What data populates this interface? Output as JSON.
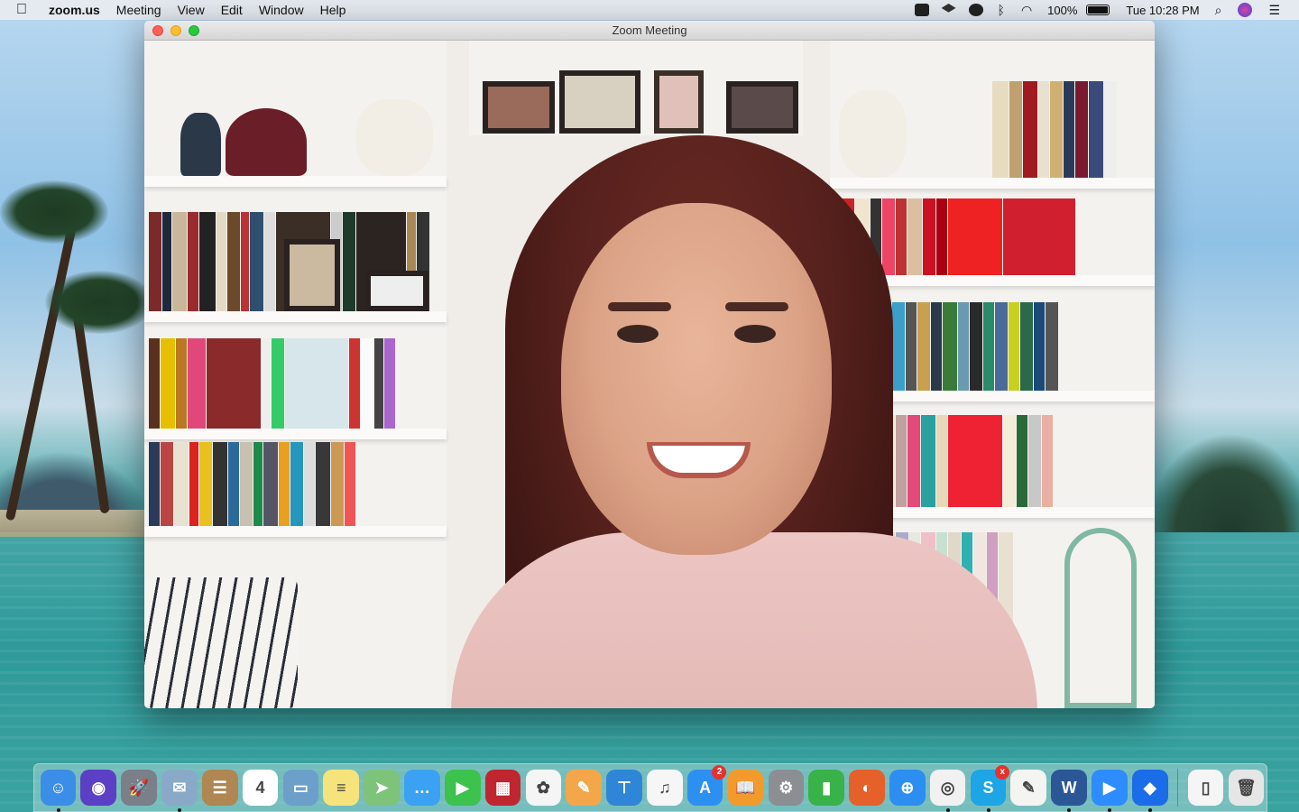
{
  "menubar": {
    "app_name": "zoom.us",
    "menus": [
      "Meeting",
      "View",
      "Edit",
      "Window",
      "Help"
    ],
    "battery": "100%",
    "clock": "Tue 10:28 PM",
    "status_icons": [
      "zoom-status-icon",
      "dropbox-status-icon",
      "skype-status-icon",
      "bluetooth-icon",
      "wifi-icon"
    ]
  },
  "window": {
    "title": "Zoom Meeting"
  },
  "dock": {
    "apps": [
      {
        "name": "Finder",
        "icon": "finder-icon",
        "color": "#3b8ee8",
        "glyph": "☺",
        "running": true
      },
      {
        "name": "Siri",
        "icon": "siri-icon",
        "color": "#5b3fc4",
        "glyph": "◉",
        "running": false
      },
      {
        "name": "Launchpad",
        "icon": "launchpad-icon",
        "color": "#7a7f8a",
        "glyph": "🚀",
        "running": false
      },
      {
        "name": "Mail",
        "icon": "mail-icon",
        "color": "#8aa9c8",
        "glyph": "✉",
        "running": true
      },
      {
        "name": "Contacts",
        "icon": "contacts-icon",
        "color": "#b08652",
        "glyph": "☰",
        "running": false
      },
      {
        "name": "Calendar",
        "icon": "calendar-icon",
        "color": "#ffffff",
        "glyph": "4",
        "running": false
      },
      {
        "name": "Preview",
        "icon": "preview-icon",
        "color": "#6c9fc9",
        "glyph": "▭",
        "running": false
      },
      {
        "name": "Notes",
        "icon": "notes-icon",
        "color": "#f7e37b",
        "glyph": "≡",
        "running": false
      },
      {
        "name": "Maps",
        "icon": "maps-icon",
        "color": "#7ec37a",
        "glyph": "➤",
        "running": false
      },
      {
        "name": "Messages",
        "icon": "messages-icon",
        "color": "#3ba1f3",
        "glyph": "…",
        "running": false
      },
      {
        "name": "FaceTime",
        "icon": "facetime-icon",
        "color": "#3cc24d",
        "glyph": "▶",
        "running": false
      },
      {
        "name": "Photo Booth",
        "icon": "photo-booth-icon",
        "color": "#c0262f",
        "glyph": "▦",
        "running": false
      },
      {
        "name": "Photos",
        "icon": "photos-icon",
        "color": "#f5f5f5",
        "glyph": "✿",
        "running": false
      },
      {
        "name": "Pages",
        "icon": "pages-icon",
        "color": "#f3a64a",
        "glyph": "✎",
        "running": false
      },
      {
        "name": "Keynote",
        "icon": "keynote-icon",
        "color": "#2f86d6",
        "glyph": "⊤",
        "running": false
      },
      {
        "name": "iTunes",
        "icon": "itunes-icon",
        "color": "#f6f6f6",
        "glyph": "♫",
        "running": false
      },
      {
        "name": "App Store",
        "icon": "app-store-icon",
        "color": "#2d8ff0",
        "glyph": "A",
        "running": false,
        "badge": "2"
      },
      {
        "name": "Books",
        "icon": "books-icon",
        "color": "#f29a2c",
        "glyph": "📖",
        "running": false
      },
      {
        "name": "System Preferences",
        "icon": "system-preferences-icon",
        "color": "#8b8e93",
        "glyph": "⚙",
        "running": false
      },
      {
        "name": "Numbers",
        "icon": "numbers-icon",
        "color": "#39b24a",
        "glyph": "▮",
        "running": false
      },
      {
        "name": "Firefox",
        "icon": "firefox-icon",
        "color": "#e6602a",
        "glyph": "◐",
        "running": false
      },
      {
        "name": "Safari",
        "icon": "safari-icon",
        "color": "#2c8ef0",
        "glyph": "⊕",
        "running": false
      },
      {
        "name": "Chrome",
        "icon": "chrome-icon",
        "color": "#f1f1f1",
        "glyph": "◎",
        "running": true
      },
      {
        "name": "Skype",
        "icon": "skype-icon",
        "color": "#1ea5e5",
        "glyph": "S",
        "running": true,
        "badge": "x"
      },
      {
        "name": "TextEdit",
        "icon": "textedit-icon",
        "color": "#f4f4f0",
        "glyph": "✎",
        "running": false
      },
      {
        "name": "Word",
        "icon": "word-icon",
        "color": "#2b5797",
        "glyph": "W",
        "running": true
      },
      {
        "name": "Zoom",
        "icon": "zoom-icon",
        "color": "#2d8cff",
        "glyph": "▶",
        "running": true
      },
      {
        "name": "Dropbox",
        "icon": "dropbox-icon",
        "color": "#1a6ce8",
        "glyph": "◆",
        "running": true
      }
    ],
    "trailing": [
      {
        "name": "Documents",
        "icon": "document-icon",
        "color": "#f5f5f5",
        "glyph": "▯"
      },
      {
        "name": "Trash",
        "icon": "trash-icon",
        "color": "#e6e6e6",
        "glyph": "🗑"
      }
    ]
  }
}
